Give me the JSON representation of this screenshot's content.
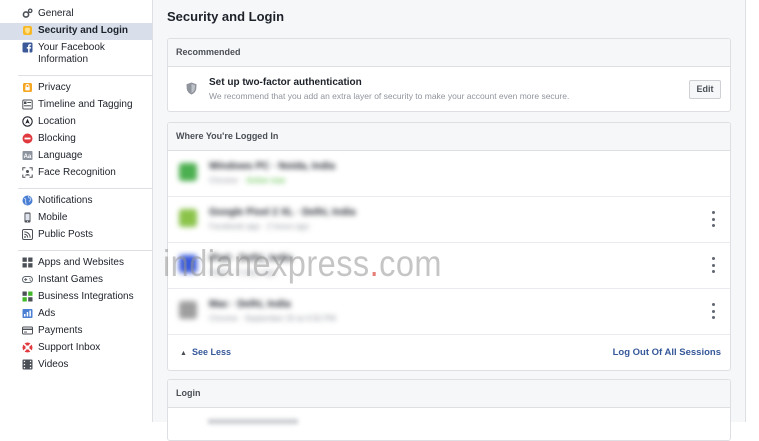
{
  "sidebar": {
    "groups": [
      [
        {
          "label": "General",
          "icon": "gear-icon"
        },
        {
          "label": "Security and Login",
          "icon": "shield-icon",
          "active": true
        },
        {
          "label": "Your Facebook Information",
          "icon": "facebook-icon"
        }
      ],
      [
        {
          "label": "Privacy",
          "icon": "lock-icon"
        },
        {
          "label": "Timeline and Tagging",
          "icon": "timeline-icon"
        },
        {
          "label": "Location",
          "icon": "location-icon"
        },
        {
          "label": "Blocking",
          "icon": "block-icon"
        },
        {
          "label": "Language",
          "icon": "language-icon"
        },
        {
          "label": "Face Recognition",
          "icon": "face-recognition-icon"
        }
      ],
      [
        {
          "label": "Notifications",
          "icon": "globe-icon"
        },
        {
          "label": "Mobile",
          "icon": "mobile-icon"
        },
        {
          "label": "Public Posts",
          "icon": "rss-icon"
        }
      ],
      [
        {
          "label": "Apps and Websites",
          "icon": "apps-icon"
        },
        {
          "label": "Instant Games",
          "icon": "gamepad-icon"
        },
        {
          "label": "Business Integrations",
          "icon": "business-icon"
        },
        {
          "label": "Ads",
          "icon": "ads-icon"
        },
        {
          "label": "Payments",
          "icon": "credit-card-icon"
        },
        {
          "label": "Support Inbox",
          "icon": "lifebuoy-icon"
        },
        {
          "label": "Videos",
          "icon": "video-icon"
        }
      ]
    ]
  },
  "main": {
    "title": "Security and Login",
    "recommended": {
      "header": "Recommended",
      "tfa_title": "Set up two-factor authentication",
      "tfa_desc": "We recommend that you add an extra layer of security to make your account even more secure.",
      "edit_label": "Edit"
    },
    "sessions": {
      "header": "Where You're Logged In",
      "items": [
        {
          "name": "Windows PC · Noida, India",
          "meta": "Chrome ·",
          "status": "Active now",
          "icon_color": "#4caf50",
          "kebab": false
        },
        {
          "name": "Google Pixel 2 XL · Delhi, India",
          "meta": "Facebook app · 2 hours ago",
          "status": "",
          "icon_color": "#8bc34a",
          "kebab": true
        },
        {
          "name": "iPad · Delhi, India",
          "meta": "Safari · 5 days ago",
          "status": "",
          "icon_color": "#3b5bdb",
          "kebab": true
        },
        {
          "name": "Mac · Delhi, India",
          "meta": "Chrome · September 20 at 4:50 PM",
          "status": "",
          "icon_color": "#9e9e9e",
          "kebab": true
        }
      ],
      "see_less": "See Less",
      "logout_all": "Log Out Of All Sessions"
    },
    "login": {
      "header": "Login"
    }
  },
  "watermark": {
    "text": "indianexpress",
    "dot": ".",
    "tld": "com"
  },
  "colors": {
    "active_bg": "#d8dfea",
    "link": "#365899",
    "active_now": "#42b72a",
    "page_bg": "#f6f7f9"
  }
}
